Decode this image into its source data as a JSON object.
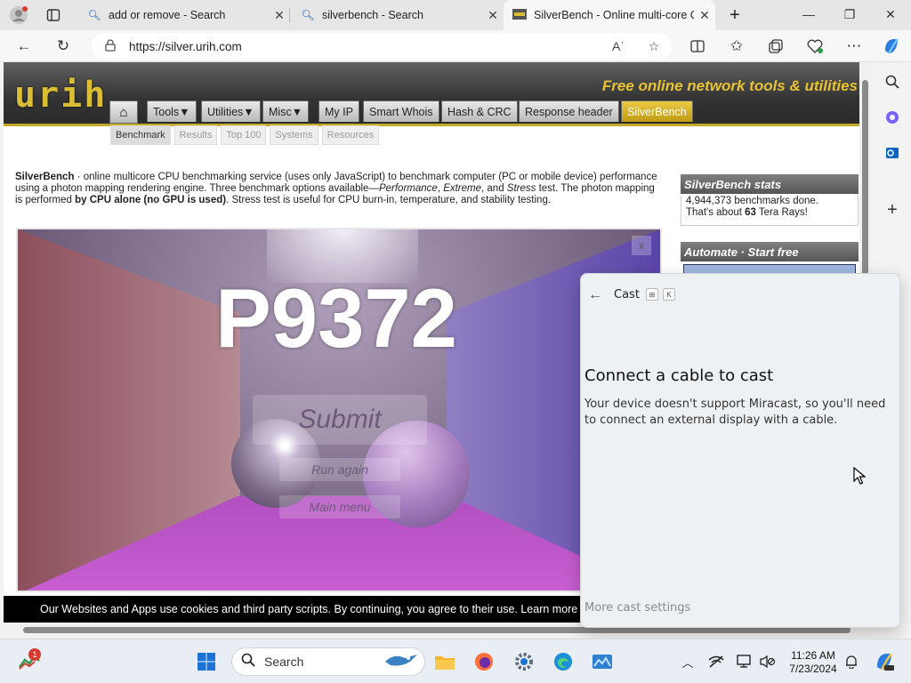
{
  "browser": {
    "tabs": [
      {
        "title": "add or remove - Search"
      },
      {
        "title": "silverbench - Search"
      },
      {
        "title": "SilverBench - Online multi-core C"
      }
    ],
    "url": "https://silver.urih.com"
  },
  "site": {
    "logo": "urih",
    "tagline": "Free online network tools & utilities",
    "nav": [
      "Tools▼",
      "Utilities▼",
      "Misc▼",
      "My IP",
      "Smart Whois",
      "Hash & CRC",
      "Response header",
      "SilverBench"
    ],
    "subnav": [
      "Benchmark",
      "Results",
      "Top 100",
      "Systems",
      "Resources"
    ],
    "intro": {
      "p1": "SilverBench",
      "p2": " · online multicore CPU benchmarking service (uses only JavaScript) to benchmark computer (PC or mobile device) performance using a photon mapping rendering engine. Three benchmark options available—",
      "p3": "Performance",
      "p4": ", ",
      "p5": "Extreme",
      "p6": ", and ",
      "p7": "Stress",
      "p8": " test. The photon mapping is performed ",
      "p9": "by CPU alone (no GPU is used)",
      "p10": ". Stress test is useful for CPU burn-in, temperature, and stability testing."
    },
    "benchmark": {
      "score": "P9372",
      "submit": "Submit",
      "run_again": "Run again",
      "main_menu": "Main menu",
      "close": "x"
    },
    "stats": {
      "title": "SilverBench stats",
      "line1": "4,944,373 benchmarks done.",
      "line2a": "That's about ",
      "line2b": "63",
      "line2c": " Tera Rays!"
    },
    "automate_title": "Automate · Start free",
    "cookie_text": "Our Websites and Apps use cookies and third party scripts. By continuing, you agree to their use. Learn more"
  },
  "cast_panel": {
    "title": "Cast",
    "key1": "⊞",
    "key2": "K",
    "heading": "Connect a cable to cast",
    "body": "Your device doesn't support Miracast, so you'll need to connect an external display with a cable.",
    "more": "More cast settings"
  },
  "taskbar": {
    "search_placeholder": "Search",
    "badge": "1",
    "time": "11:26 AM",
    "date": "7/23/2024"
  },
  "colors": {
    "accent_gold": "#d9bd35",
    "active_nav": "#c19b12"
  }
}
